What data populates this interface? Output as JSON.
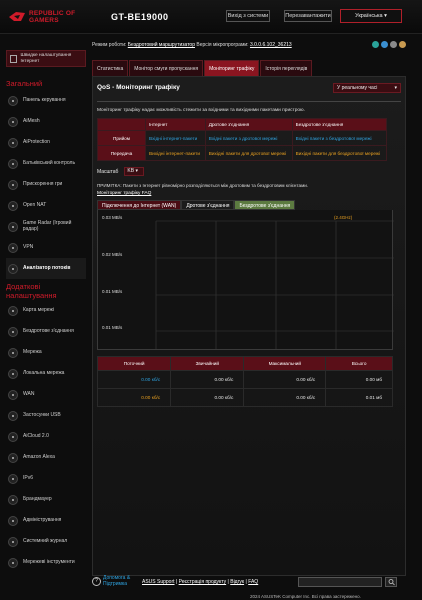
{
  "header": {
    "brand_line1": "REPUBLIC OF",
    "brand_line2": "GAMERS",
    "model": "GT-BE19000",
    "logout_label": "Вихід з системи",
    "reboot_label": "Перезавантажити",
    "language": "Українська"
  },
  "status": {
    "mode_label": "Режим роботи:",
    "mode_value": "Бездротовий маршрутизатор",
    "firmware_label": "Версія мікропрограми:",
    "firmware_value": "3.0.0.6.102_36213"
  },
  "sidebar": {
    "quick_setup": "Швидке налаштування Інтернет",
    "general_title": "Загальний",
    "general_items": [
      {
        "label": "Панель керування",
        "icon": "dashboard-icon"
      },
      {
        "label": "AiMesh",
        "icon": "mesh-icon"
      },
      {
        "label": "AiProtection",
        "icon": "shield-icon"
      },
      {
        "label": "Батьківський контроль",
        "icon": "parental-icon"
      },
      {
        "label": "Прискорення гри",
        "icon": "game-icon"
      },
      {
        "label": "Open NAT",
        "icon": "nat-icon"
      },
      {
        "label": "Game Radar (Ігровий радар)",
        "icon": "radar-icon"
      },
      {
        "label": "VPN",
        "icon": "vpn-icon"
      },
      {
        "label": "Аналізатор потоків",
        "icon": "analyzer-icon"
      }
    ],
    "advanced_title": "Додаткові налаштування",
    "advanced_items": [
      {
        "label": "Карта мережі",
        "icon": "map-icon"
      },
      {
        "label": "Бездротове з'єднання",
        "icon": "wifi-icon"
      },
      {
        "label": "Мережа",
        "icon": "network-icon"
      },
      {
        "label": "Локальна мережа",
        "icon": "lan-icon"
      },
      {
        "label": "WAN",
        "icon": "globe-icon"
      },
      {
        "label": "Застосунки USB",
        "icon": "usb-icon"
      },
      {
        "label": "AiCloud 2.0",
        "icon": "cloud-icon"
      },
      {
        "label": "Amazon Alexa",
        "icon": "alexa-icon"
      },
      {
        "label": "IPv6",
        "icon": "ipv6-icon"
      },
      {
        "label": "Брандмауер",
        "icon": "firewall-icon"
      },
      {
        "label": "Адміністрування",
        "icon": "admin-icon"
      },
      {
        "label": "Системний журнал",
        "icon": "log-icon"
      },
      {
        "label": "Мережеві інструменти",
        "icon": "tools-icon"
      }
    ]
  },
  "tabs": [
    "Статистика",
    "Монітор смуги пропускання",
    "Моніторинг трафіку",
    "Історія переглядів"
  ],
  "panel": {
    "title": "QoS - Моніторинг трафіку",
    "mode_select": "У реальному часі",
    "description": "Моніторинг трафіку надає можливість стежити за вхідними та вихідними пакетами пристрою.",
    "legend": {
      "headers": [
        "Інтернет",
        "Дротове з'єднання",
        "Бездротове з'єднання"
      ],
      "rows": [
        {
          "label": "Прийом",
          "cells": [
            "Вхідні інтернет-пакети",
            "Вхідні пакети з дротової мережі",
            "Вхідні пакети з бездротової мережі"
          ]
        },
        {
          "label": "Передача",
          "cells": [
            "Вихідні інтернет-пакети",
            "Вихідні пакети для дротової мережі",
            "Вихідні пакети для бездротової мережі"
          ]
        }
      ]
    },
    "scale_label": "Масштаб",
    "scale_value": "KB",
    "note": "ПРИМІТКА: Пакети з Інтернет рівномірно розподіляються між дротовим та бездротовим клієнтами.",
    "faq": "Моніторинг трафіку FAQ",
    "chart_tabs": [
      "Підключення до Інтернет (WAN)",
      "Дротове з'єднання",
      "Бездротове з'єднання"
    ],
    "chart_tab_suffix": "(2.4GHz)",
    "chart_ticks": [
      "0.03 MB/s",
      "0.02 MB/s",
      "0.01 MB/s",
      "0.01 MB/s"
    ],
    "stats_headers": [
      "Поточний",
      "Звичайний",
      "Максимальний",
      "Всього"
    ],
    "stats_rows": [
      {
        "values": [
          "0.00 кб/с",
          "0.00 кб/с",
          "0.00 кб/с",
          "0.00 мб"
        ],
        "color": "#2fa3e0"
      },
      {
        "values": [
          "0.00 кб/с",
          "0.00 кб/с",
          "0.00 кб/с",
          "0.01 мб"
        ],
        "color": "#e8a020"
      }
    ]
  },
  "footer": {
    "help": "Допомога & Підтримка",
    "links": [
      "ASUS Support",
      "Реєстрація продукту",
      "Відгук",
      "FAQ"
    ],
    "copyright": "2024 ASUSTeK Computer Inc. Всі права застережено."
  },
  "colors": {
    "accent": "#d01b2a",
    "tab_active": "#8a1520",
    "cyan": "#2fa3e0",
    "orange": "#e8a020"
  }
}
